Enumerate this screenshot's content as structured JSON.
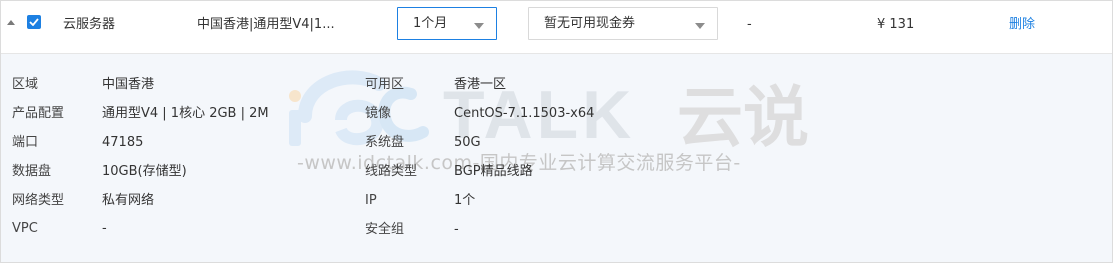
{
  "row": {
    "product": "云服务器",
    "spec_summary": "中国香港|通用型V4|1...",
    "period": {
      "selected": "1个月"
    },
    "coupon": {
      "selected": "暂无可用现金券"
    },
    "discount": "-",
    "price": "¥ 131",
    "delete_label": "删除",
    "checked": true
  },
  "details": {
    "left": [
      {
        "label": "区域",
        "value": "中国香港"
      },
      {
        "label": "产品配置",
        "value": "通用型V4 | 1核心 2GB | 2M"
      },
      {
        "label": "端口",
        "value": "47185"
      },
      {
        "label": "数据盘",
        "value": "10GB(存储型)"
      },
      {
        "label": "网络类型",
        "value": "私有网络"
      },
      {
        "label": "VPC",
        "value": "-"
      }
    ],
    "right": [
      {
        "label": "可用区",
        "value": "香港一区"
      },
      {
        "label": "镜像",
        "value": "CentOS-7.1.1503-x64"
      },
      {
        "label": "系统盘",
        "value": "50G"
      },
      {
        "label": "线路类型",
        "value": "BGP精品线路"
      },
      {
        "label": "IP",
        "value": "1个"
      },
      {
        "label": "安全组",
        "value": "-"
      }
    ]
  },
  "watermark": {
    "brand_text": "TALK 云说",
    "tagline": "-www.idctalk.com-国内专业云计算交流服务平台-"
  },
  "colors": {
    "accent": "#1d80e2",
    "detail_bg": "#f4f7fb",
    "watermark": "#c8c8c8"
  }
}
